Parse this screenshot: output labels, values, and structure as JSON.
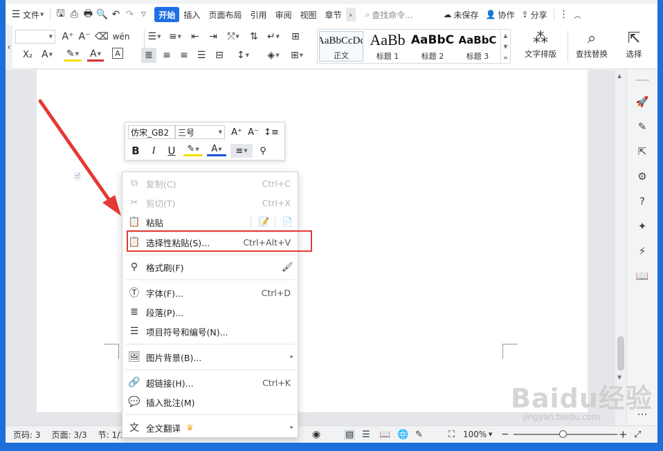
{
  "menubar": {
    "file": "文件",
    "tabs": [
      "开始",
      "插入",
      "页面布局",
      "引用",
      "审阅",
      "视图",
      "章节"
    ],
    "search_placeholder": "查找命令...",
    "unsaved": "未保存",
    "collab": "协作",
    "share": "分享"
  },
  "ribbon": {
    "styles": [
      {
        "preview": "AaBbCcDd",
        "name": "正文"
      },
      {
        "preview": "AaBb",
        "name": "标题 1"
      },
      {
        "preview": "AaBbC",
        "name": "标题 2"
      },
      {
        "preview": "AaBbC",
        "name": "标题 3"
      }
    ],
    "text_layout": "文字排版",
    "find_replace": "查找替换",
    "select": "选择"
  },
  "mini_toolbar": {
    "font": "仿宋_GB2",
    "size": "三号",
    "bold": "B",
    "italic": "I",
    "underline": "U"
  },
  "context_menu": {
    "copy": {
      "label": "复制(C)",
      "shortcut": "Ctrl+C"
    },
    "cut": {
      "label": "剪切(T)",
      "shortcut": "Ctrl+X"
    },
    "paste": {
      "label": "粘贴"
    },
    "paste_special": {
      "label": "选择性粘贴(S)...",
      "shortcut": "Ctrl+Alt+V"
    },
    "format_painter": {
      "label": "格式刷(F)"
    },
    "font": {
      "label": "字体(F)...",
      "shortcut": "Ctrl+D"
    },
    "paragraph": {
      "label": "段落(P)..."
    },
    "bullets": {
      "label": "项目符号和编号(N)..."
    },
    "picture_bg": {
      "label": "图片背景(B)..."
    },
    "hyperlink": {
      "label": "超链接(H)...",
      "shortcut": "Ctrl+K"
    },
    "comment": {
      "label": "插入批注(M)"
    },
    "translate": {
      "label": "全文翻译"
    }
  },
  "status": {
    "page_num": "页码: 3",
    "pages": "页面: 3/3",
    "section": "节: 1/1",
    "zoom": "100%"
  },
  "watermark": {
    "main": "Baidu经验",
    "sub": "jingyan.baidu.com"
  },
  "colors": {
    "accent": "#1d6fe5",
    "highlight_box": "#e53935",
    "arrow": "#e53935"
  }
}
